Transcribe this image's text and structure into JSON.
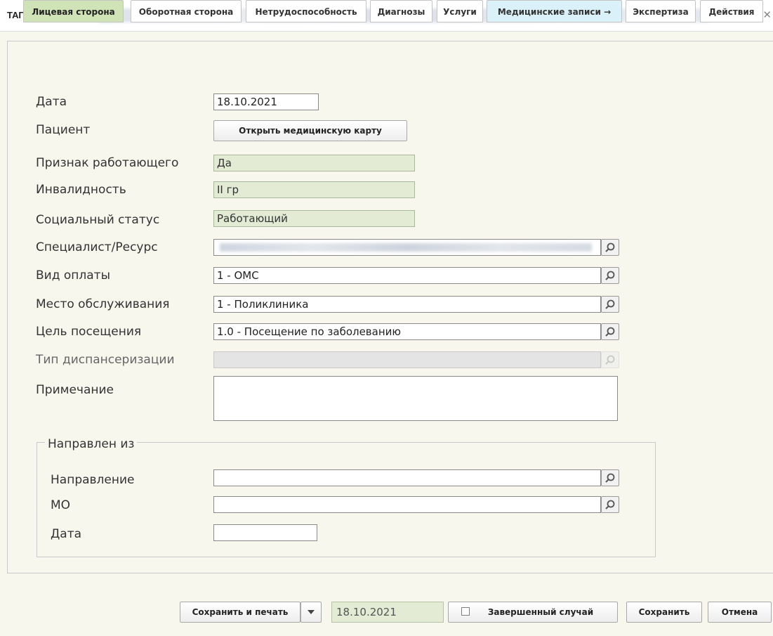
{
  "window": {
    "title": "ТАП/МКАБ №",
    "close_icon": "close-icon"
  },
  "tabs": [
    {
      "label": "Лицевая сторона"
    },
    {
      "label": "Оборотная сторона"
    },
    {
      "label": "Нетрудоспособность"
    },
    {
      "label": "Диагнозы"
    },
    {
      "label": "Услуги"
    },
    {
      "label": "Медицинские записи →"
    },
    {
      "label": "Экспертиза"
    },
    {
      "label": "Действия"
    }
  ],
  "form": {
    "date_label": "Дата",
    "date_value": "18.10.2021",
    "patient_label": "Пациент",
    "open_card_button": "Открыть медицинскую карту",
    "working_label": "Признак работающего",
    "working_value": "Да",
    "disability_label": "Инвалидность",
    "disability_value": "II гр",
    "social_label": "Социальный статус",
    "social_value": "Работающий",
    "specialist_label": "Специалист/Ресурс",
    "payment_label": "Вид оплаты",
    "payment_value": "1 - ОМС",
    "place_label": "Место обслуживания",
    "place_value": "1 - Поликлиника",
    "purpose_label": "Цель посещения",
    "purpose_value": "1.0 - Посещение по заболеванию",
    "dispensary_label": "Тип диспансеризации",
    "note_label": "Примечание"
  },
  "referral": {
    "legend": "Направлен из",
    "direction_label": "Направление",
    "mo_label": "МО",
    "date_label": "Дата"
  },
  "footer": {
    "save_print_button": "Сохранить и печать",
    "date_value": "18.10.2021",
    "completed_label": "Завершенный случай",
    "save_button": "Сохранить",
    "cancel_button": "Отмена"
  },
  "colors": {
    "active_tab": "#cfe3b7",
    "info_tab": "#daf1f9",
    "readonly_field": "#e3ebd4",
    "background": "#f7f7ee"
  }
}
